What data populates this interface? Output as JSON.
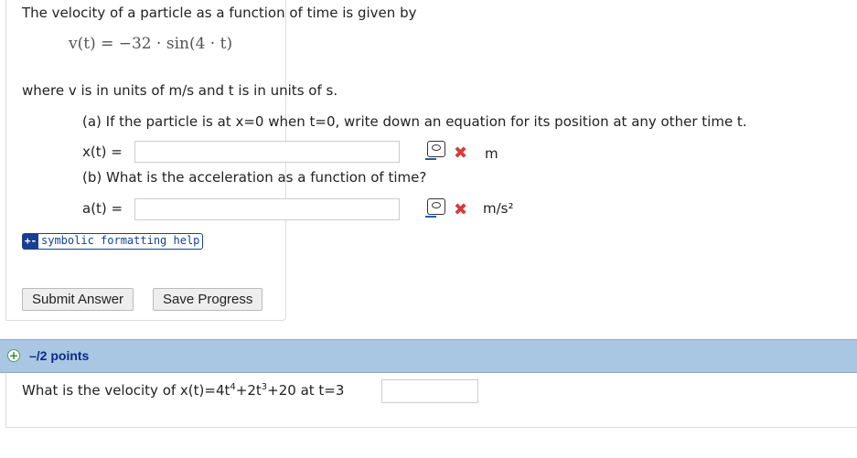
{
  "question1": {
    "intro": "The velocity of a particle as a function of time is given by",
    "equation": "v(t) = −32 · sin(4 · t)",
    "units_text": "where v is in units of m/s and t is in units of s.",
    "part_a": "(a) If the particle is at x=0 when t=0, write down an equation for its position at any other time t.",
    "part_b": "(b) What is the acceleration as a function of time?",
    "x_label": "x(t) =",
    "x_unit": "m",
    "a_label": "a(t) =",
    "a_unit": "m/s²",
    "x_value": "",
    "a_value": "",
    "help_label": "symbolic formatting help",
    "submit_label": "Submit Answer",
    "save_label": "Save Progress"
  },
  "question2": {
    "points": "–/2 points",
    "prompt_prefix": "What is the velocity of x(t)=4t",
    "exp1": "4",
    "prompt_mid": "+2t",
    "exp2": "3",
    "prompt_suffix": "+20 at t=3",
    "answer_value": ""
  },
  "colors": {
    "band": "#a9c6e2",
    "points_text": "#0b2a8a",
    "error_mark": "#d83a3a",
    "help_blue": "#1a3f91"
  }
}
